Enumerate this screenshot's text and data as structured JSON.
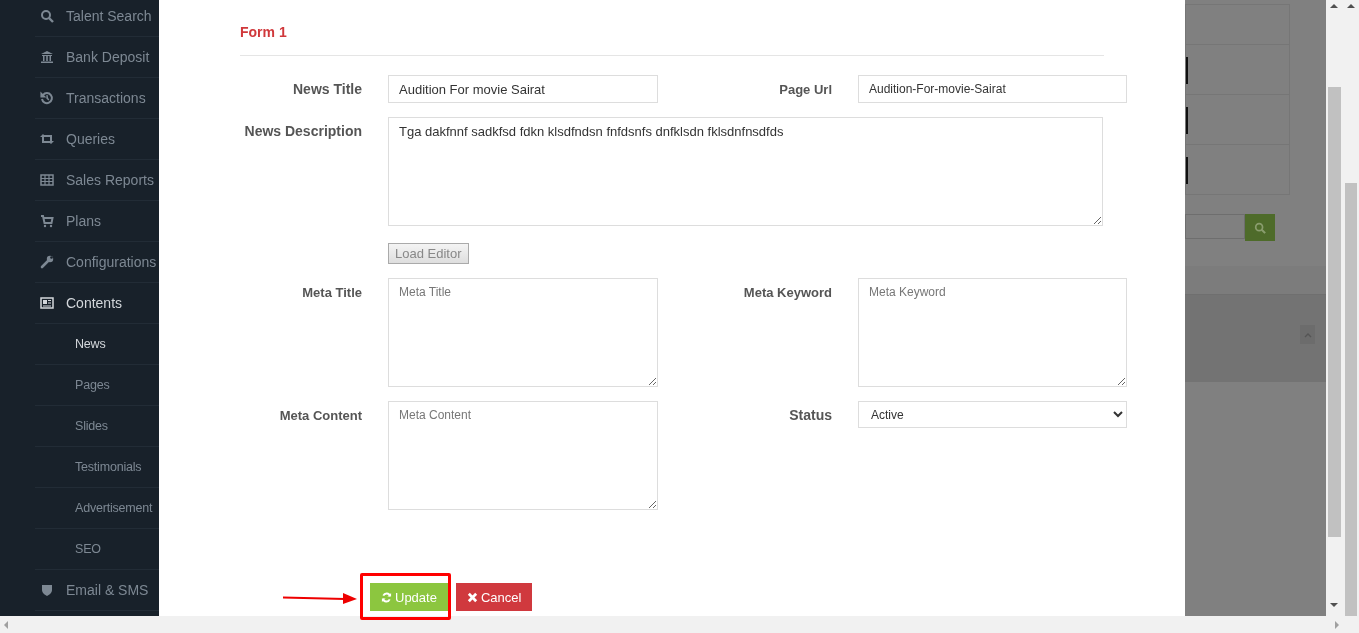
{
  "sidebar": {
    "items": [
      {
        "label": "Talent Search",
        "selected": false
      },
      {
        "label": "Bank Deposit",
        "selected": false
      },
      {
        "label": "Transactions",
        "selected": false
      },
      {
        "label": "Queries",
        "selected": false
      },
      {
        "label": "Sales Reports",
        "selected": false
      },
      {
        "label": "Plans",
        "selected": false
      },
      {
        "label": "Configurations",
        "selected": false
      },
      {
        "label": "Contents",
        "selected": true,
        "children": [
          {
            "label": "News",
            "selected": true
          },
          {
            "label": "Pages",
            "selected": false
          },
          {
            "label": "Slides",
            "selected": false
          },
          {
            "label": "Testimonials",
            "selected": false
          },
          {
            "label": "Advertisement",
            "selected": false
          },
          {
            "label": "SEO",
            "selected": false
          }
        ]
      },
      {
        "label": "Email & SMS",
        "selected": false
      }
    ]
  },
  "form": {
    "title": "Form 1",
    "news_title": {
      "label": "News Title",
      "value": "Audition For movie Sairat"
    },
    "page_url": {
      "label": "Page Url",
      "value": "Audition-For-movie-Sairat"
    },
    "news_description": {
      "label": "News Description",
      "value": "Tga dakfnnf sadkfsd fdkn klsdfndsn fnfdsnfs dnfklsdn fklsdnfnsdfds"
    },
    "load_editor": {
      "label": "Load Editor"
    },
    "meta_title": {
      "label": "Meta Title",
      "placeholder": "Meta Title"
    },
    "meta_keyword": {
      "label": "Meta Keyword",
      "placeholder": "Meta Keyword"
    },
    "meta_content": {
      "label": "Meta Content",
      "placeholder": "Meta Content"
    },
    "status": {
      "label": "Status",
      "value": "Active"
    },
    "buttons": [
      {
        "label": "Update",
        "kind": "update",
        "highlighted": true
      },
      {
        "label": "Cancel",
        "kind": "cancel",
        "highlighted": false
      }
    ]
  }
}
